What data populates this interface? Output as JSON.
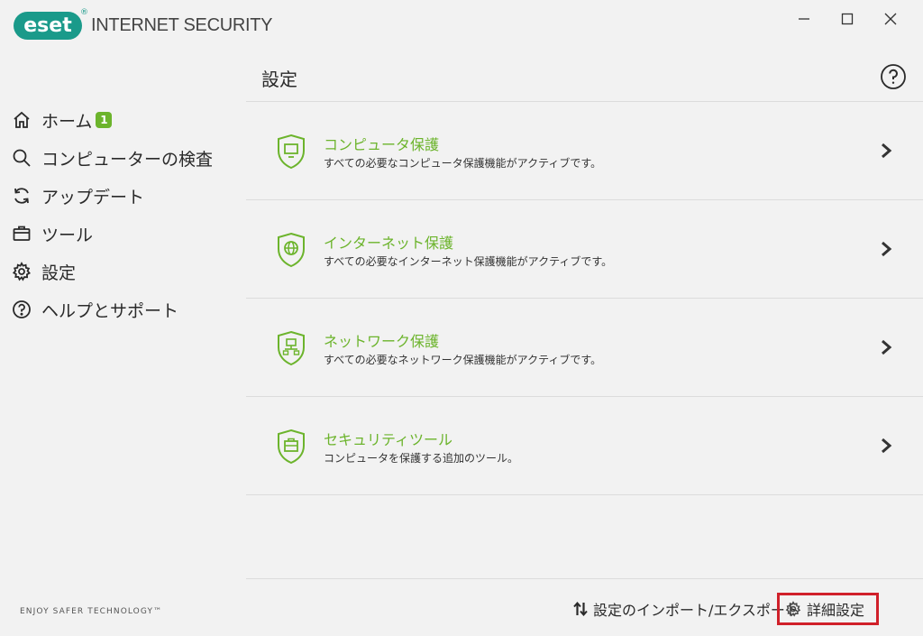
{
  "app": {
    "logo_text": "eset",
    "logo_reg": "®",
    "product_name": "INTERNET SECURITY"
  },
  "window_controls": {
    "minimize": "minimize-icon",
    "maximize": "maximize-icon",
    "close": "close-icon"
  },
  "sidebar": {
    "items": [
      {
        "label": "ホーム",
        "icon": "home-icon",
        "badge": "1"
      },
      {
        "label": "コンピューターの検査",
        "icon": "search-icon"
      },
      {
        "label": "アップデート",
        "icon": "refresh-icon"
      },
      {
        "label": "ツール",
        "icon": "toolbox-icon"
      },
      {
        "label": "設定",
        "icon": "gear-icon",
        "active": true
      },
      {
        "label": "ヘルプとサポート",
        "icon": "help-icon"
      }
    ],
    "tagline": "ENJOY SAFER TECHNOLOGY™"
  },
  "main": {
    "title": "設定",
    "rows": [
      {
        "title": "コンピュータ保護",
        "desc": "すべての必要なコンピュータ保護機能がアクティブです。",
        "icon": "monitor-shield-icon"
      },
      {
        "title": "インターネット保護",
        "desc": "すべての必要なインターネット保護機能がアクティブです。",
        "icon": "globe-shield-icon"
      },
      {
        "title": "ネットワーク保護",
        "desc": "すべての必要なネットワーク保護機能がアクティブです。",
        "icon": "network-shield-icon"
      },
      {
        "title": "セキュリティツール",
        "desc": "コンピュータを保護する追加のツール。",
        "icon": "toolbox-shield-icon"
      }
    ]
  },
  "footer": {
    "import_export": "設定のインポート/エクスポート",
    "advanced": "詳細設定"
  },
  "colors": {
    "accent_green": "#6cb42c",
    "brand_teal": "#1a9a8a",
    "highlight_red": "#d0202a",
    "background": "#f2f2f2"
  }
}
